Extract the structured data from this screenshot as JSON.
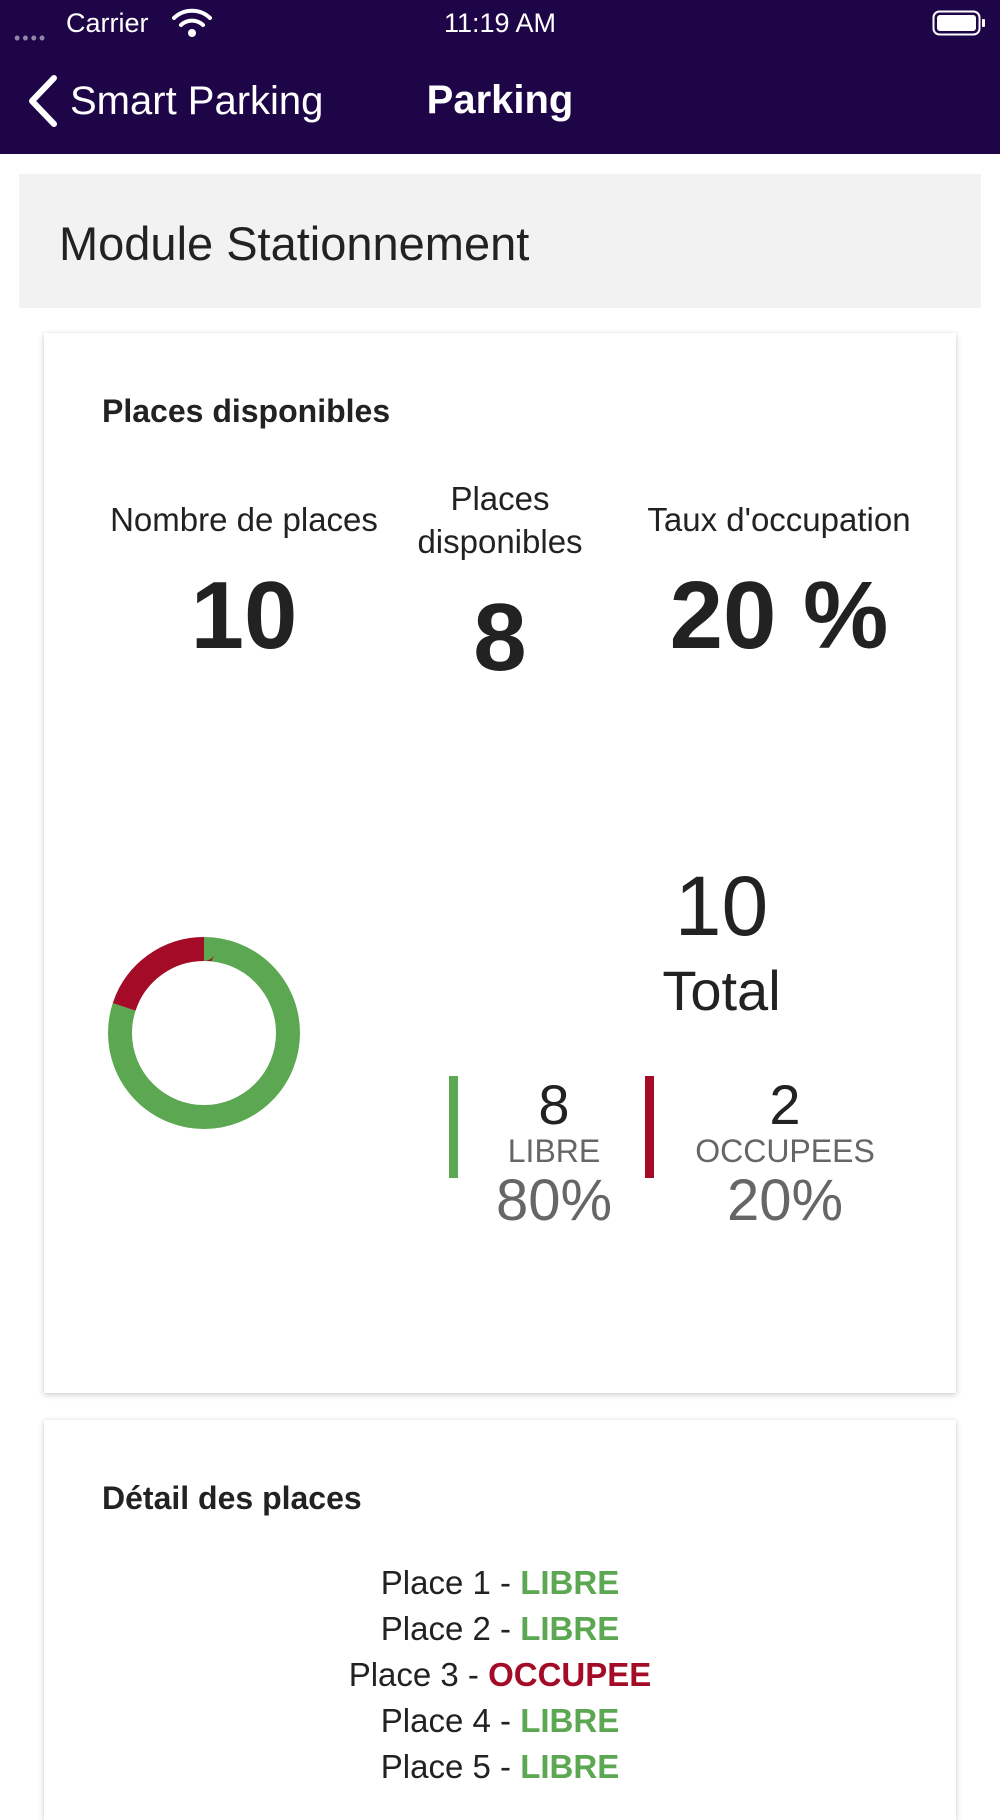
{
  "status_bar": {
    "signal": "••••",
    "carrier": "Carrier",
    "time": "11:19 AM"
  },
  "nav": {
    "back_label": "Smart Parking",
    "title": "Parking"
  },
  "module": {
    "title": "Module Stationnement"
  },
  "availability_card": {
    "title": "Places disponibles",
    "stats": [
      {
        "label": "Nombre de places",
        "value": "10"
      },
      {
        "label": "Places disponibles",
        "value": "8"
      },
      {
        "label": "Taux d'occupation",
        "value": "20 %"
      }
    ],
    "total_value": "10",
    "total_label": "Total",
    "legend": [
      {
        "count": "8",
        "name": "LIBRE",
        "percent": "80%",
        "color": "#5ca752"
      },
      {
        "count": "2",
        "name": "OCCUPEES",
        "percent": "20%",
        "color": "#a30b27"
      }
    ]
  },
  "chart_data": {
    "type": "pie",
    "donut": true,
    "categories": [
      "LIBRE",
      "OCCUPEES"
    ],
    "values": [
      8,
      2
    ],
    "colors": [
      "#5ca752",
      "#a30b27"
    ]
  },
  "detail_card": {
    "title": "Détail des places",
    "places": [
      {
        "label": "Place 1 - ",
        "status": "LIBRE",
        "state": "libre"
      },
      {
        "label": "Place 2 - ",
        "status": "LIBRE",
        "state": "libre"
      },
      {
        "label": "Place 3 - ",
        "status": "OCCUPEE",
        "state": "occupee"
      },
      {
        "label": "Place 4 - ",
        "status": "LIBRE",
        "state": "libre"
      },
      {
        "label": "Place 5 - ",
        "status": "LIBRE",
        "state": "libre"
      }
    ]
  }
}
